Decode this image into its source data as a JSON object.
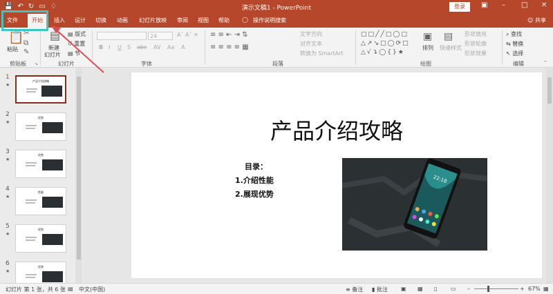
{
  "window": {
    "title": "演示文稿1 - PowerPoint",
    "login_label": "登录",
    "share_label": "共享"
  },
  "tabs": [
    "文件",
    "开始",
    "插入",
    "设计",
    "切换",
    "动画",
    "幻灯片放映",
    "审阅",
    "视图",
    "帮助"
  ],
  "tell_me": "操作说明搜索",
  "ribbon": {
    "clipboard": {
      "label": "剪贴板",
      "paste": "粘贴"
    },
    "slides": {
      "label": "幻灯片",
      "new_slide_1": "新建",
      "new_slide_2": "幻灯片",
      "layout": "版式",
      "reset": "重置",
      "section": "节"
    },
    "font": {
      "label": "字体",
      "size": "24"
    },
    "paragraph": {
      "label": "段落",
      "text_direction": "文字方向",
      "align_text": "对齐文本",
      "smartart": "转换为 SmartArt"
    },
    "drawing": {
      "label": "绘图",
      "arrange": "排列",
      "quick_styles": "快速样式",
      "shape_fill": "形状填充",
      "shape_outline": "形状轮廓",
      "shape_effects": "形状效果"
    },
    "editing": {
      "label": "编辑",
      "find": "查找",
      "replace": "替换",
      "select": "选择"
    }
  },
  "thumbnails": [
    {
      "num": "1",
      "title": "产品介绍攻略",
      "has_photo": true
    },
    {
      "num": "2",
      "title": "优势",
      "has_photo": true
    },
    {
      "num": "3",
      "title": "优势",
      "has_photo": true
    },
    {
      "num": "4",
      "title": "性能",
      "has_photo": true
    },
    {
      "num": "5",
      "title": "优势",
      "has_photo": true
    },
    {
      "num": "6",
      "title": "优势",
      "has_photo": true
    }
  ],
  "slide": {
    "title": "产品介绍攻略",
    "list_head": "目录：",
    "items": [
      "1.介绍性能",
      "2.展现优势"
    ],
    "phone_time": "22:18"
  },
  "status": {
    "slide_info": "幻灯片 第 1 张，共 6 张",
    "language": "中文(中国)",
    "notes": "备注",
    "comments": "批注",
    "zoom": "67%"
  },
  "colors": {
    "accent": "#b7472a",
    "highlight": "#38c7c3",
    "arrow": "#e04b53"
  }
}
